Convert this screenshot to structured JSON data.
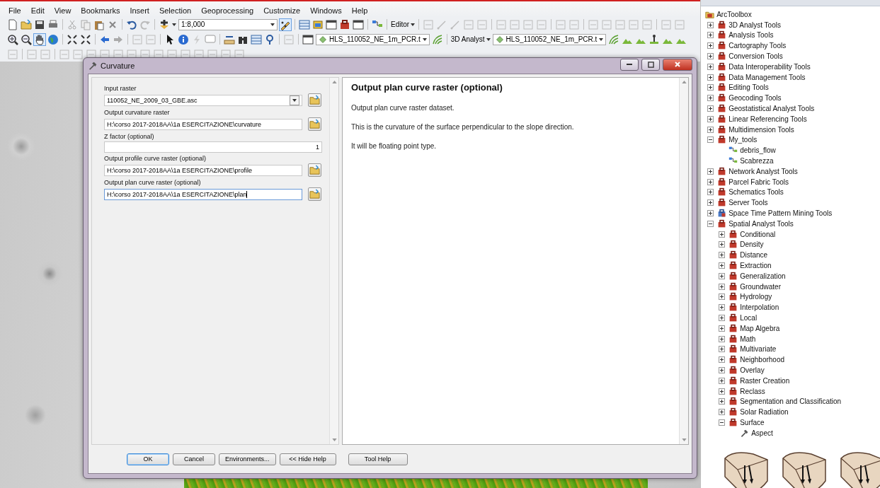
{
  "menu": [
    "File",
    "Edit",
    "View",
    "Bookmarks",
    "Insert",
    "Selection",
    "Geoprocessing",
    "Customize",
    "Windows",
    "Help"
  ],
  "toolbar": {
    "scale": "1:8,000",
    "editor": "Editor",
    "layer_1": "HLS_110052_NE_1m_PCR.t",
    "analyst": "3D Analyst",
    "layer_2": "HLS_110052_NE_1m_PCR.t"
  },
  "dialog": {
    "title": "Curvature",
    "params": [
      {
        "label": "Input raster",
        "value": "110052_NE_2009_03_GBE.asc",
        "kind": "combo",
        "focused": false
      },
      {
        "label": "Output curvature raster",
        "value": "H:\\corso 2017-2018AA\\1a ESERCITAZIONE\\curvature",
        "kind": "path",
        "focused": false
      },
      {
        "label": "Z factor (optional)",
        "value": "1",
        "kind": "number",
        "focused": false
      },
      {
        "label": "Output profile curve raster (optional)",
        "value": "H:\\corso 2017-2018AA\\1a ESERCITAZIONE\\profile",
        "kind": "path",
        "focused": false
      },
      {
        "label": "Output plan curve raster (optional)",
        "value": "H:\\corso 2017-2018AA\\1a ESERCITAZIONE\\plan",
        "kind": "path",
        "focused": true
      }
    ],
    "help": {
      "heading": "Output plan curve raster (optional)",
      "paragraphs": [
        "Output plan curve raster dataset.",
        "This is the curvature of the surface perpendicular to the slope direction.",
        "It will be floating point type."
      ]
    },
    "buttons": [
      {
        "label": "OK",
        "default": true
      },
      {
        "label": "Cancel",
        "default": false
      },
      {
        "label": "Environments...",
        "default": false
      },
      {
        "label": "<< Hide Help",
        "default": false
      },
      {
        "label": "Tool Help",
        "default": false
      }
    ]
  },
  "toolbox": {
    "root": "ArcToolbox",
    "items": [
      {
        "label": "3D Analyst Tools",
        "kind": "toolbox",
        "expanded": false
      },
      {
        "label": "Analysis Tools",
        "kind": "toolbox",
        "expanded": false
      },
      {
        "label": "Cartography Tools",
        "kind": "toolbox",
        "expanded": false
      },
      {
        "label": "Conversion Tools",
        "kind": "toolbox",
        "expanded": false
      },
      {
        "label": "Data Interoperability Tools",
        "kind": "toolbox",
        "expanded": false
      },
      {
        "label": "Data Management Tools",
        "kind": "toolbox",
        "expanded": false
      },
      {
        "label": "Editing Tools",
        "kind": "toolbox",
        "expanded": false
      },
      {
        "label": "Geocoding Tools",
        "kind": "toolbox",
        "expanded": false
      },
      {
        "label": "Geostatistical Analyst Tools",
        "kind": "toolbox",
        "expanded": false
      },
      {
        "label": "Linear Referencing Tools",
        "kind": "toolbox",
        "expanded": false
      },
      {
        "label": "Multidimension Tools",
        "kind": "toolbox",
        "expanded": false
      },
      {
        "label": "My_tools",
        "kind": "toolbox",
        "expanded": true,
        "children": [
          {
            "label": "debris_flow",
            "kind": "model"
          },
          {
            "label": "Scabrezza",
            "kind": "model"
          }
        ]
      },
      {
        "label": "Network Analyst Tools",
        "kind": "toolbox",
        "expanded": false
      },
      {
        "label": "Parcel Fabric Tools",
        "kind": "toolbox",
        "expanded": false
      },
      {
        "label": "Schematics Tools",
        "kind": "toolbox",
        "expanded": false
      },
      {
        "label": "Server Tools",
        "kind": "toolbox",
        "expanded": false
      },
      {
        "label": "Space Time Pattern Mining Tools",
        "kind": "pytoolbox",
        "expanded": false
      },
      {
        "label": "Spatial Analyst Tools",
        "kind": "toolbox",
        "expanded": true,
        "children": [
          {
            "label": "Conditional",
            "kind": "toolset",
            "expanded": false
          },
          {
            "label": "Density",
            "kind": "toolset",
            "expanded": false
          },
          {
            "label": "Distance",
            "kind": "toolset",
            "expanded": false
          },
          {
            "label": "Extraction",
            "kind": "toolset",
            "expanded": false
          },
          {
            "label": "Generalization",
            "kind": "toolset",
            "expanded": false
          },
          {
            "label": "Groundwater",
            "kind": "toolset",
            "expanded": false
          },
          {
            "label": "Hydrology",
            "kind": "toolset",
            "expanded": false
          },
          {
            "label": "Interpolation",
            "kind": "toolset",
            "expanded": false
          },
          {
            "label": "Local",
            "kind": "toolset",
            "expanded": false
          },
          {
            "label": "Map Algebra",
            "kind": "toolset",
            "expanded": false
          },
          {
            "label": "Math",
            "kind": "toolset",
            "expanded": false
          },
          {
            "label": "Multivariate",
            "kind": "toolset",
            "expanded": false
          },
          {
            "label": "Neighborhood",
            "kind": "toolset",
            "expanded": false
          },
          {
            "label": "Overlay",
            "kind": "toolset",
            "expanded": false
          },
          {
            "label": "Raster Creation",
            "kind": "toolset",
            "expanded": false
          },
          {
            "label": "Reclass",
            "kind": "toolset",
            "expanded": false
          },
          {
            "label": "Segmentation and Classification",
            "kind": "toolset",
            "expanded": false
          },
          {
            "label": "Solar Radiation",
            "kind": "toolset",
            "expanded": false
          },
          {
            "label": "Surface",
            "kind": "toolset",
            "expanded": true,
            "children": [
              {
                "label": "Aspect",
                "kind": "tool"
              }
            ]
          }
        ]
      }
    ]
  }
}
